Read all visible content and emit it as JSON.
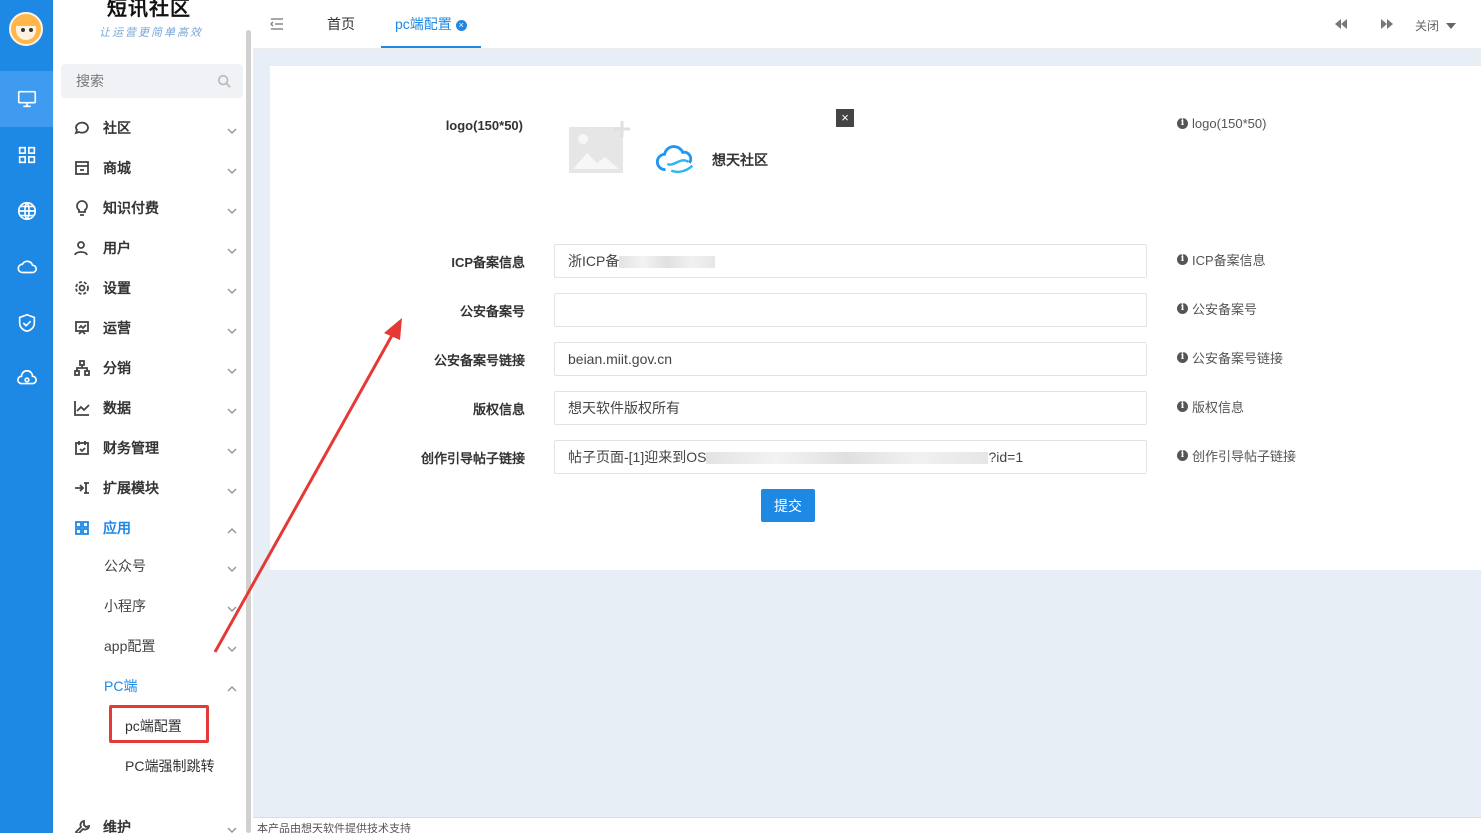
{
  "rail": {
    "items": [
      "monitor-icon",
      "grid-icon",
      "globe-icon",
      "cloud-icon",
      "shield-icon",
      "cloud-service-icon"
    ]
  },
  "brand": {
    "title": "短讯社区",
    "slogan": "让运营更简单高效"
  },
  "search": {
    "placeholder": "搜索"
  },
  "menu": [
    {
      "label": "社区",
      "icon": "chat-icon"
    },
    {
      "label": "商城",
      "icon": "store-icon"
    },
    {
      "label": "知识付费",
      "icon": "bulb-icon"
    },
    {
      "label": "用户",
      "icon": "user-icon"
    },
    {
      "label": "设置",
      "icon": "gear-icon"
    },
    {
      "label": "运营",
      "icon": "board-icon"
    },
    {
      "label": "分销",
      "icon": "hierarchy-icon"
    },
    {
      "label": "数据",
      "icon": "line-chart-icon"
    },
    {
      "label": "财务管理",
      "icon": "calendar-icon"
    },
    {
      "label": "扩展模块",
      "icon": "extend-icon"
    },
    {
      "label": "应用",
      "icon": "apps-icon"
    }
  ],
  "submenu": {
    "items": [
      "公众号",
      "小程序",
      "app配置",
      "PC端"
    ],
    "pc_children": [
      "pc端配置",
      "PC端强制跳转"
    ],
    "maintain": "维护"
  },
  "topbar": {
    "home_tab": "首页",
    "active_tab": "pc端配置",
    "close_label": "关闭"
  },
  "form": {
    "logo_label": "logo(150*50)",
    "logo_text": "想天社区",
    "logo_help": "logo(150*50)",
    "close_symbol": "×",
    "fields": [
      {
        "label": "ICP备案信息",
        "value": "浙ICP备",
        "help": "ICP备案信息"
      },
      {
        "label": "公安备案号",
        "value": "",
        "help": "公安备案号"
      },
      {
        "label": "公安备案号链接",
        "value": "beian.miit.gov.cn",
        "help": "公安备案号链接"
      },
      {
        "label": "版权信息",
        "value": "想天软件版权所有",
        "help": "版权信息"
      },
      {
        "label": "创作引导帖子链接",
        "value": "帖子页面-[1]迎来到OS",
        "value_tail": "?id=1",
        "help": "创作引导帖子链接"
      }
    ],
    "submit_label": "提交"
  },
  "footer": {
    "text": "本产品由想天软件提供技术支持"
  },
  "colors": {
    "primary": "#1e88e5",
    "annotation": "#e53935"
  }
}
